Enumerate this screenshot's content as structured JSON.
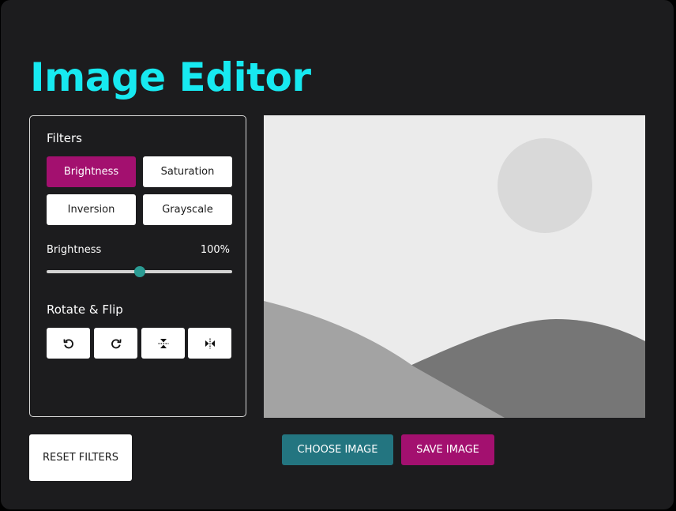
{
  "app": {
    "title": "Image Editor"
  },
  "filters": {
    "heading": "Filters",
    "buttons": [
      {
        "label": "Brightness",
        "active": true
      },
      {
        "label": "Saturation",
        "active": false
      },
      {
        "label": "Inversion",
        "active": false
      },
      {
        "label": "Grayscale",
        "active": false
      }
    ],
    "slider": {
      "label": "Brightness",
      "value_text": "100%",
      "value": 100,
      "min": 0,
      "max": 200
    }
  },
  "rotate_flip": {
    "heading": "Rotate & Flip",
    "buttons": [
      {
        "icon": "rotate-left-icon"
      },
      {
        "icon": "rotate-right-icon"
      },
      {
        "icon": "flip-vertical-icon"
      },
      {
        "icon": "flip-horizontal-icon"
      }
    ]
  },
  "preview": {
    "icon": "image-placeholder-icon"
  },
  "actions": {
    "reset_label": "RESET FILTERS",
    "choose_label": "CHOOSE IMAGE",
    "save_label": "SAVE IMAGE"
  },
  "colors": {
    "background": "#1c1c1e",
    "title": "#17e9f0",
    "accent": "#a3106f",
    "choose": "#237580",
    "slider_thumb": "#2b9c94"
  }
}
